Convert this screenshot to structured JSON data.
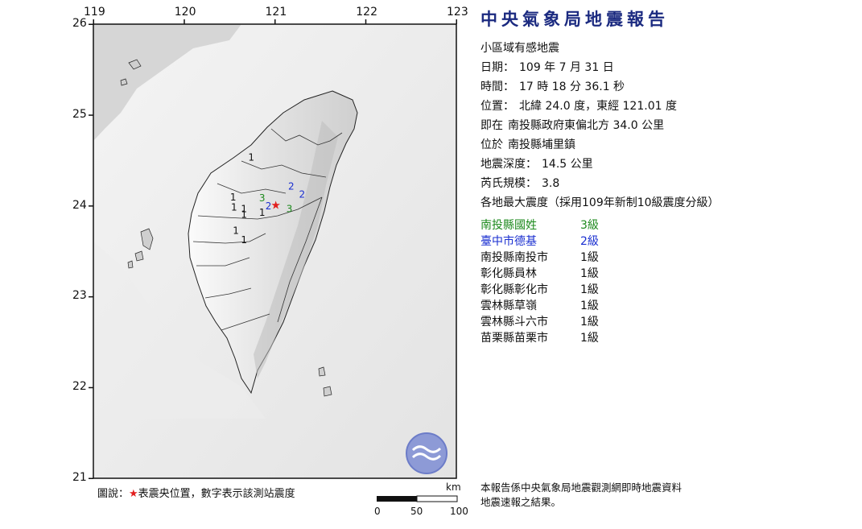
{
  "map": {
    "lon_ticks": [
      "119",
      "120",
      "121",
      "122",
      "123"
    ],
    "lat_ticks": [
      "26",
      "25",
      "24",
      "23",
      "22",
      "21"
    ],
    "epicenter_symbol": "★",
    "station_marks": [
      {
        "v": "1",
        "color": "#111111",
        "lon": 120.74,
        "lat": 24.53
      },
      {
        "v": "2",
        "color": "#1a2fd0",
        "lon": 121.18,
        "lat": 24.21
      },
      {
        "v": "2",
        "color": "#1a2fd0",
        "lon": 121.3,
        "lat": 24.12
      },
      {
        "v": "3",
        "color": "#1e8a1e",
        "lon": 120.86,
        "lat": 24.08
      },
      {
        "v": "2",
        "color": "#1a2fd0",
        "lon": 120.93,
        "lat": 23.99
      },
      {
        "v": "3",
        "color": "#1e8a1e",
        "lon": 121.16,
        "lat": 23.96
      },
      {
        "v": "1",
        "color": "#111111",
        "lon": 120.54,
        "lat": 24.09
      },
      {
        "v": "1",
        "color": "#111111",
        "lon": 120.55,
        "lat": 23.98
      },
      {
        "v": "1",
        "color": "#111111",
        "lon": 120.66,
        "lat": 23.96
      },
      {
        "v": "1",
        "color": "#111111",
        "lon": 120.66,
        "lat": 23.9
      },
      {
        "v": "1",
        "color": "#111111",
        "lon": 120.86,
        "lat": 23.92
      },
      {
        "v": "1",
        "color": "#111111",
        "lon": 120.57,
        "lat": 23.72
      },
      {
        "v": "1",
        "color": "#111111",
        "lon": 120.66,
        "lat": 23.62
      }
    ],
    "scale_unit": "km",
    "scale_labels": [
      "0",
      "50",
      "100"
    ],
    "logo": "cwb-logo"
  },
  "report": {
    "title": "中央氣象局地震報告",
    "subtitle": "小區域有感地震",
    "date_label": "日期：",
    "date_value": "109 年 7 月 31 日",
    "time_label": "時間：",
    "time_value": "17 時 18 分 36.1 秒",
    "pos_label": "位置：",
    "pos_value": "北緯 24.0 度，東經 121.01 度",
    "near_label": "即在",
    "near_value": "南投縣政府東偏北方 34.0 公里",
    "in_label": "位於",
    "in_value": "南投縣埔里鎮",
    "depth_label": "地震深度：",
    "depth_value": "14.5 公里",
    "mag_label": "芮氏規模：",
    "mag_value": "3.8",
    "intensity_header": "各地最大震度（採用109年新制10級震度分級）"
  },
  "intensities": [
    {
      "location": "南投縣國姓",
      "level": "3級",
      "color": "#1e8a1e"
    },
    {
      "location": "臺中市德基",
      "level": "2級",
      "color": "#1a2fd0"
    },
    {
      "location": "南投縣南投市",
      "level": "1級",
      "color": "#111111"
    },
    {
      "location": "彰化縣員林",
      "level": "1級",
      "color": "#111111"
    },
    {
      "location": "彰化縣彰化市",
      "level": "1級",
      "color": "#111111"
    },
    {
      "location": "雲林縣草嶺",
      "level": "1級",
      "color": "#111111"
    },
    {
      "location": "雲林縣斗六市",
      "level": "1級",
      "color": "#111111"
    },
    {
      "location": "苗栗縣苗栗市",
      "level": "1級",
      "color": "#111111"
    }
  ],
  "legend": {
    "prefix": "圖說：",
    "star": "★",
    "text": "表震央位置，數字表示該測站震度"
  },
  "footer": {
    "line1": "本報告係中央氣象局地震觀測網即時地震資料",
    "line2": "地震速報之結果。"
  }
}
